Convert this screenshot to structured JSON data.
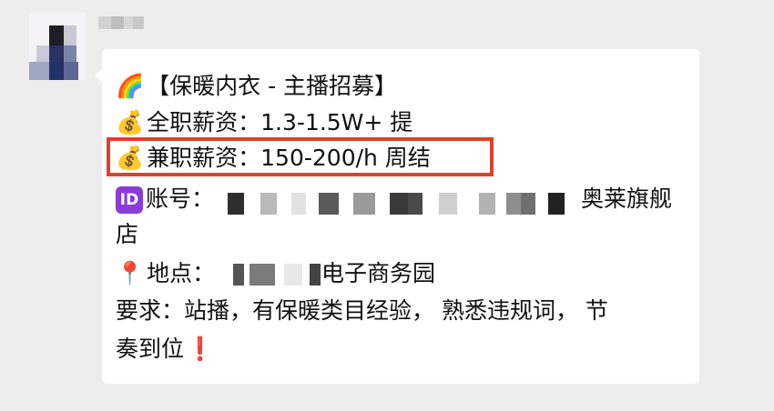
{
  "message": {
    "title_line": "【保暖内衣 - 主播招募】",
    "fulltime_salary": "全职薪资：1.3-1.5W+ 提",
    "parttime_salary": "兼职薪资：150-200/h 周结",
    "account_label": "账号：",
    "account_tail": "奥莱旗舰",
    "account_wrap": "店",
    "location_label": "地点：",
    "location_tail": "电子商务园",
    "requirement_line1": "要求：站播，有保暖类目经验， 熟悉违规词， 节",
    "requirement_line2": "奏到位"
  },
  "icons": {
    "title": "rainbow-icon",
    "fulltime": "money-bag-icon",
    "parttime": "money-bag-icon",
    "account": "id-badge-icon",
    "location": "round-pushpin-icon",
    "requirement_end": "exclamation-mark-icon"
  },
  "colors": {
    "page_background": "#ededed",
    "bubble_background": "#ffffff",
    "highlight_border": "#e0402a",
    "id_badge": "#8b3bd6",
    "text": "#111111"
  }
}
